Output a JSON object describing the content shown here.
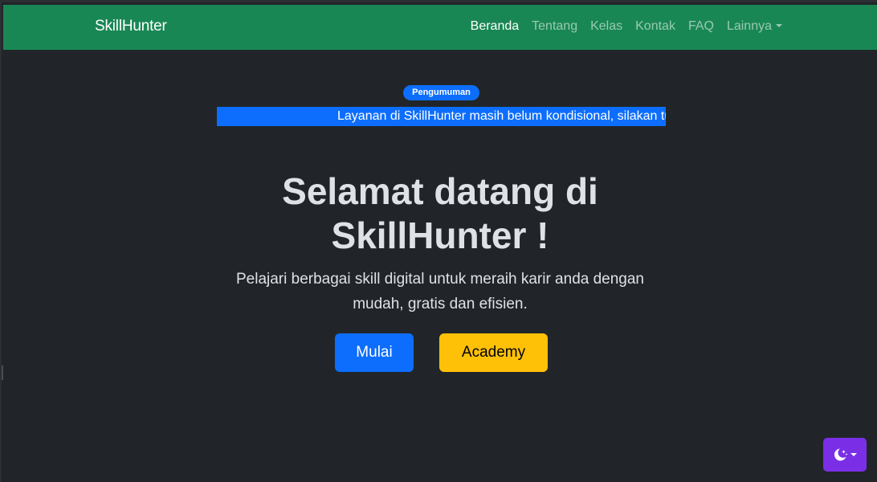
{
  "navbar": {
    "brand": "SkillHunter",
    "items": [
      {
        "label": "Beranda",
        "active": true
      },
      {
        "label": "Tentang",
        "active": false
      },
      {
        "label": "Kelas",
        "active": false
      },
      {
        "label": "Kontak",
        "active": false
      },
      {
        "label": "FAQ",
        "active": false
      },
      {
        "label": "Lainnya",
        "active": false,
        "dropdown": true
      }
    ]
  },
  "announcement": {
    "badge": "Pengumuman",
    "text": "Layanan di SkillHunter masih belum kondisional, silakan tu"
  },
  "hero": {
    "title_line1": "Selamat datang di",
    "title_line2": "SkillHunter !",
    "subtitle": "Pelajari berbagai skill digital untuk meraih karir anda dengan mudah, gratis dan efisien.",
    "primary_button": "Mulai",
    "secondary_button": "Academy"
  },
  "theme_toggle": {
    "icon": "moon-stars-icon"
  },
  "colors": {
    "navbar": "#198754",
    "background": "#212529",
    "primary": "#0d6efd",
    "warning": "#ffc107",
    "theme_toggle": "#7a2fe6"
  }
}
